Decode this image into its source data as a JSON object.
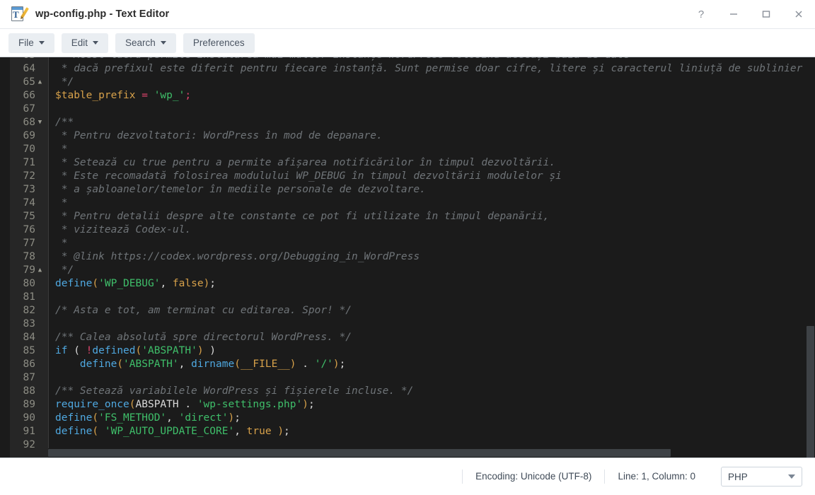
{
  "window": {
    "title": "wp-config.php - Text Editor",
    "icon": "text-editor-icon",
    "controls": {
      "help": "?",
      "minimize": "minimize-icon",
      "maximize": "maximize-icon",
      "close": "close-icon"
    }
  },
  "toolbar": {
    "buttons": [
      {
        "label": "File",
        "has_caret": true
      },
      {
        "label": "Edit",
        "has_caret": true
      },
      {
        "label": "Search",
        "has_caret": true
      },
      {
        "label": "Preferences",
        "has_caret": false
      }
    ]
  },
  "editor": {
    "first_visible_line": 63,
    "lines": [
      {
        "num": 63,
        "fold": "",
        "clipped": true,
        "tokens": [
          {
            "t": " * Acest lucru permite instalarea mai multor instanțe WordPress folosind aceeași bază de date",
            "c": "c-com"
          }
        ]
      },
      {
        "num": 64,
        "fold": "",
        "tokens": [
          {
            "t": " * dacă prefixul este diferit pentru fiecare instanță. Sunt permise doar cifre, litere și caracterul liniuță de sublinier",
            "c": "c-com"
          }
        ]
      },
      {
        "num": 65,
        "fold": "up",
        "tokens": [
          {
            "t": " */",
            "c": "c-com"
          }
        ]
      },
      {
        "num": 66,
        "fold": "",
        "tokens": [
          {
            "t": "$table_prefix",
            "c": "c-var"
          },
          {
            "t": " ",
            "c": "c-plain"
          },
          {
            "t": "=",
            "c": "c-op"
          },
          {
            "t": " ",
            "c": "c-plain"
          },
          {
            "t": "'wp_'",
            "c": "c-str"
          },
          {
            "t": ";",
            "c": "c-op"
          }
        ]
      },
      {
        "num": 67,
        "fold": "",
        "tokens": []
      },
      {
        "num": 68,
        "fold": "down",
        "tokens": [
          {
            "t": "/**",
            "c": "c-com"
          }
        ]
      },
      {
        "num": 69,
        "fold": "",
        "tokens": [
          {
            "t": " * Pentru dezvoltatori: WordPress în mod de depanare.",
            "c": "c-com"
          }
        ]
      },
      {
        "num": 70,
        "fold": "",
        "tokens": [
          {
            "t": " *",
            "c": "c-com"
          }
        ]
      },
      {
        "num": 71,
        "fold": "",
        "tokens": [
          {
            "t": " * Setează cu true pentru a permite afișarea notificărilor în timpul dezvoltării.",
            "c": "c-com"
          }
        ]
      },
      {
        "num": 72,
        "fold": "",
        "tokens": [
          {
            "t": " * Este recomadată folosirea modulului WP_DEBUG în timpul dezvoltării modulelor și",
            "c": "c-com"
          }
        ]
      },
      {
        "num": 73,
        "fold": "",
        "tokens": [
          {
            "t": " * a șabloanelor/temelor în mediile personale de dezvoltare.",
            "c": "c-com"
          }
        ]
      },
      {
        "num": 74,
        "fold": "",
        "tokens": [
          {
            "t": " *",
            "c": "c-com"
          }
        ]
      },
      {
        "num": 75,
        "fold": "",
        "tokens": [
          {
            "t": " * Pentru detalii despre alte constante ce pot fi utilizate în timpul depanării,",
            "c": "c-com"
          }
        ]
      },
      {
        "num": 76,
        "fold": "",
        "tokens": [
          {
            "t": " * vizitează Codex-ul.",
            "c": "c-com"
          }
        ]
      },
      {
        "num": 77,
        "fold": "",
        "tokens": [
          {
            "t": " *",
            "c": "c-com"
          }
        ]
      },
      {
        "num": 78,
        "fold": "",
        "tokens": [
          {
            "t": " * @link https://codex.wordpress.org/Debugging_in_WordPress",
            "c": "c-com"
          }
        ]
      },
      {
        "num": 79,
        "fold": "up",
        "tokens": [
          {
            "t": " */",
            "c": "c-com"
          }
        ]
      },
      {
        "num": 80,
        "fold": "",
        "tokens": [
          {
            "t": "define",
            "c": "c-fn"
          },
          {
            "t": "(",
            "c": "c-paren"
          },
          {
            "t": "'WP_DEBUG'",
            "c": "c-str"
          },
          {
            "t": ",",
            "c": "c-plain"
          },
          {
            "t": " ",
            "c": "c-plain"
          },
          {
            "t": "false",
            "c": "c-const"
          },
          {
            "t": ")",
            "c": "c-paren"
          },
          {
            "t": ";",
            "c": "c-plain"
          }
        ]
      },
      {
        "num": 81,
        "fold": "",
        "tokens": []
      },
      {
        "num": 82,
        "fold": "",
        "tokens": [
          {
            "t": "/* Asta e tot, am terminat cu editarea. Spor! */",
            "c": "c-com"
          }
        ]
      },
      {
        "num": 83,
        "fold": "",
        "tokens": []
      },
      {
        "num": 84,
        "fold": "",
        "tokens": [
          {
            "t": "/** Calea absolută spre directorul WordPress. */",
            "c": "c-com"
          }
        ]
      },
      {
        "num": 85,
        "fold": "",
        "tokens": [
          {
            "t": "if",
            "c": "c-kw"
          },
          {
            "t": " ",
            "c": "c-plain"
          },
          {
            "t": "(",
            "c": "c-plain"
          },
          {
            "t": " ",
            "c": "c-plain"
          },
          {
            "t": "!",
            "c": "c-op"
          },
          {
            "t": "defined",
            "c": "c-fn"
          },
          {
            "t": "(",
            "c": "c-paren"
          },
          {
            "t": "'ABSPATH'",
            "c": "c-str"
          },
          {
            "t": ")",
            "c": "c-paren"
          },
          {
            "t": " ",
            "c": "c-plain"
          },
          {
            "t": ")",
            "c": "c-plain"
          }
        ]
      },
      {
        "num": 86,
        "fold": "",
        "tokens": [
          {
            "t": "    ",
            "c": "c-plain"
          },
          {
            "t": "define",
            "c": "c-fn"
          },
          {
            "t": "(",
            "c": "c-paren"
          },
          {
            "t": "'ABSPATH'",
            "c": "c-str"
          },
          {
            "t": ",",
            "c": "c-plain"
          },
          {
            "t": " ",
            "c": "c-plain"
          },
          {
            "t": "dirname",
            "c": "c-fn"
          },
          {
            "t": "(",
            "c": "c-paren"
          },
          {
            "t": "__FILE__",
            "c": "c-const"
          },
          {
            "t": ")",
            "c": "c-paren"
          },
          {
            "t": " ",
            "c": "c-plain"
          },
          {
            "t": ".",
            "c": "c-plain"
          },
          {
            "t": " ",
            "c": "c-plain"
          },
          {
            "t": "'/'",
            "c": "c-str"
          },
          {
            "t": ")",
            "c": "c-paren"
          },
          {
            "t": ";",
            "c": "c-plain"
          }
        ]
      },
      {
        "num": 87,
        "fold": "",
        "tokens": []
      },
      {
        "num": 88,
        "fold": "",
        "tokens": [
          {
            "t": "/** Setează variabilele WordPress și fișierele incluse. */",
            "c": "c-com"
          }
        ]
      },
      {
        "num": 89,
        "fold": "",
        "tokens": [
          {
            "t": "require_once",
            "c": "c-fn"
          },
          {
            "t": "(",
            "c": "c-paren"
          },
          {
            "t": "ABSPATH",
            "c": "c-plain"
          },
          {
            "t": " ",
            "c": "c-plain"
          },
          {
            "t": ".",
            "c": "c-plain"
          },
          {
            "t": " ",
            "c": "c-plain"
          },
          {
            "t": "'wp-settings.php'",
            "c": "c-str"
          },
          {
            "t": ")",
            "c": "c-paren"
          },
          {
            "t": ";",
            "c": "c-plain"
          }
        ]
      },
      {
        "num": 90,
        "fold": "",
        "tokens": [
          {
            "t": "define",
            "c": "c-fn"
          },
          {
            "t": "(",
            "c": "c-paren"
          },
          {
            "t": "'FS_METHOD'",
            "c": "c-str"
          },
          {
            "t": ",",
            "c": "c-plain"
          },
          {
            "t": " ",
            "c": "c-plain"
          },
          {
            "t": "'direct'",
            "c": "c-str"
          },
          {
            "t": ")",
            "c": "c-paren"
          },
          {
            "t": ";",
            "c": "c-plain"
          }
        ]
      },
      {
        "num": 91,
        "fold": "",
        "tokens": [
          {
            "t": "define",
            "c": "c-fn"
          },
          {
            "t": "(",
            "c": "c-paren"
          },
          {
            "t": " ",
            "c": "c-plain"
          },
          {
            "t": "'WP_AUTO_UPDATE_CORE'",
            "c": "c-str"
          },
          {
            "t": ",",
            "c": "c-plain"
          },
          {
            "t": " ",
            "c": "c-plain"
          },
          {
            "t": "true",
            "c": "c-const"
          },
          {
            "t": " ",
            "c": "c-plain"
          },
          {
            "t": ")",
            "c": "c-paren"
          },
          {
            "t": ";",
            "c": "c-plain"
          }
        ]
      },
      {
        "num": 92,
        "fold": "",
        "tokens": []
      }
    ]
  },
  "statusbar": {
    "encoding": "Encoding: Unicode (UTF-8)",
    "cursor": "Line: 1, Column: 0",
    "language": "PHP"
  },
  "colors": {
    "editor_background": "#1b1b1b",
    "gutter_background": "#262626",
    "comment": "#6f7478",
    "keyword": "#4fa8e0",
    "string": "#3fbf6a",
    "variable": "#d7a14a",
    "operator": "#e0456e",
    "toolbar_button": "#eaeef2"
  }
}
